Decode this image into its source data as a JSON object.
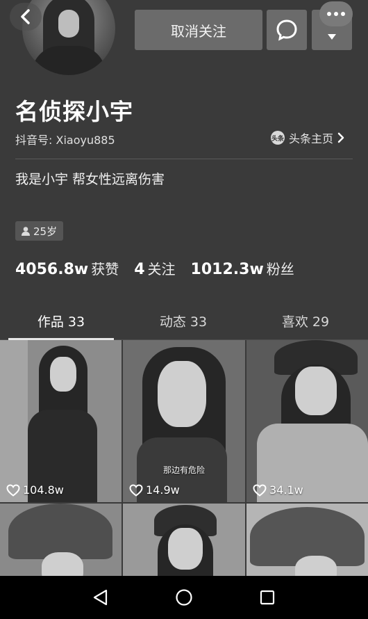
{
  "header": {
    "follow_button": "取消关注",
    "name": "名侦探小宇",
    "douyin_id": "抖音号: Xiaoyu885",
    "toutiao_badge": "头条",
    "toutiao_link": "头条主页",
    "bio": "我是小宇 帮女性远离伤害",
    "age": "25岁"
  },
  "stats": [
    {
      "value": "4056.8w",
      "label": "获赞"
    },
    {
      "value": "4",
      "label": "关注"
    },
    {
      "value": "1012.3w",
      "label": "粉丝"
    }
  ],
  "tabs": [
    {
      "label": "作品 33",
      "active": true
    },
    {
      "label": "动态 33",
      "active": false
    },
    {
      "label": "喜欢 29",
      "active": false
    }
  ],
  "videos": [
    {
      "likes": "104.8w",
      "caption": ""
    },
    {
      "likes": "14.9w",
      "caption": "那边有危险"
    },
    {
      "likes": "34.1w",
      "caption": ""
    },
    {
      "likes": "",
      "caption": ""
    },
    {
      "likes": "",
      "caption": ""
    },
    {
      "likes": "",
      "caption": ""
    }
  ],
  "icons": {
    "back": "chevron-left-icon",
    "message": "chat-bubble-icon",
    "more": "more-dots-icon",
    "dropdown": "triangle-down-icon",
    "toutiao_arrow": "chevron-right-icon",
    "age": "person-icon",
    "like": "heart-icon",
    "nav_back": "triangle-back-icon",
    "nav_home": "circle-home-icon",
    "nav_recent": "square-recent-icon"
  },
  "colors": {
    "background": "#3a3a3a",
    "button": "#6b6b6b",
    "navbar": "#000000"
  }
}
